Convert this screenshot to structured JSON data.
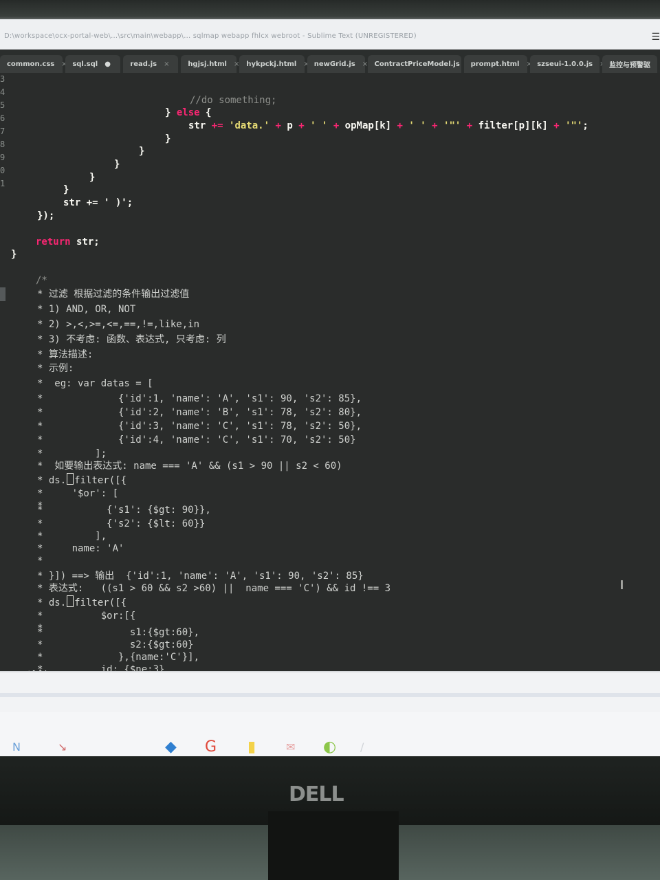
{
  "window": {
    "title": "D:\\workspace\\ocx-portal-web\\...\\src\\main\\webapp\\... sqlmap  webapp  fhlcx  webroot  - Sublime Text (UNREGISTERED)"
  },
  "tabs": [
    {
      "label": "common.css",
      "close": "×",
      "modified": false
    },
    {
      "label": "sql.sql",
      "close": "●",
      "modified": true
    },
    {
      "label": "read.js",
      "close": "×",
      "modified": false
    },
    {
      "label": "hgjsj.html",
      "close": "×",
      "modified": false
    },
    {
      "label": "hykpckj.html",
      "close": "×",
      "modified": false
    },
    {
      "label": "newGrid.js",
      "close": "×",
      "modified": false
    },
    {
      "label": "ContractPriceModel.js",
      "close": "×",
      "modified": false
    },
    {
      "label": "prompt.html",
      "close": "×",
      "modified": false
    },
    {
      "label": "szseui-1.0.0.js",
      "close": "×",
      "modified": false
    },
    {
      "label": "监控与预警驱",
      "close": "",
      "modified": false
    }
  ],
  "gutter": [
    "3",
    "4",
    "5",
    "6",
    "7",
    "8",
    "9",
    "0",
    "1"
  ],
  "code": {
    "l1": "//do something;",
    "l2_brace": "} ",
    "l2_else": "else",
    "l2_open": " {",
    "l3": "str += 'data.' + p + ' ' + opMap[k] + ' ' + '\"' + filter[p][k] + '\"';",
    "l4": "}",
    "l5": "}",
    "l6": "}",
    "l7": "}",
    "l8": "}",
    "l9": "str += ' )';",
    "l10": "});",
    "l11_kw": "return",
    "l11_rest": " str;",
    "l12": "}",
    "c1": "/*",
    "c2": "* 过滤 根据过滤的条件输出过滤值",
    "c3": "* 1) AND, OR, NOT",
    "c4": "* 2) >,<,>=,<=,==,!=,like,in",
    "c5": "* 3) 不考虑: 函数、表达式, 只考虑: 列",
    "c6": "* 算法描述:",
    "c7": "* 示例:",
    "c8": "*  eg: var datas = [",
    "c9": "*             {'id':1, 'name': 'A', 's1': 90, 's2': 85},",
    "c10": "*             {'id':2, 'name': 'B', 's1': 78, 's2': 80},",
    "c11": "*             {'id':3, 'name': 'C', 's1': 78, 's2': 50},",
    "c12": "*             {'id':4, 'name': 'C', 's1': 70, 's2': 50}",
    "c13": "*         ];",
    "c14": "*  如要输出表达式: name === 'A' && (s1 > 90 || s2 < 60)",
    "c15a": "* ds.",
    "c15b": "filter([{",
    "c16": "*     '$or': [",
    "c17": "*",
    "c18": "*           {'s1': {$gt: 90}},",
    "c19": "*           {'s2': {$lt: 60}}",
    "c20": "*         ],",
    "c21": "*     name: 'A'",
    "c22": "*",
    "c23": "* }]) ==> 输出  {'id':1, 'name': 'A', 's1': 90, 's2': 85}",
    "c24": "* 表达式:   ((s1 > 60 && s2 >60) ||  name === 'C') && id !== 3",
    "c25a": "* ds.",
    "c25b": "filter([{",
    "c26": "*          $or:[{",
    "c27": "*",
    "c28": "*               s1:{$gt:60},",
    "c29": "*               s2:{$gt:60}",
    "c30": "*             },{name:'C'}],",
    "c31": "*          id: {$ne:3}",
    "c32": "*}]);"
  },
  "monitor": {
    "brand": "DELL"
  },
  "icons": {
    "menu": "hamburger-icon",
    "ibeam": "text-cursor-icon"
  }
}
